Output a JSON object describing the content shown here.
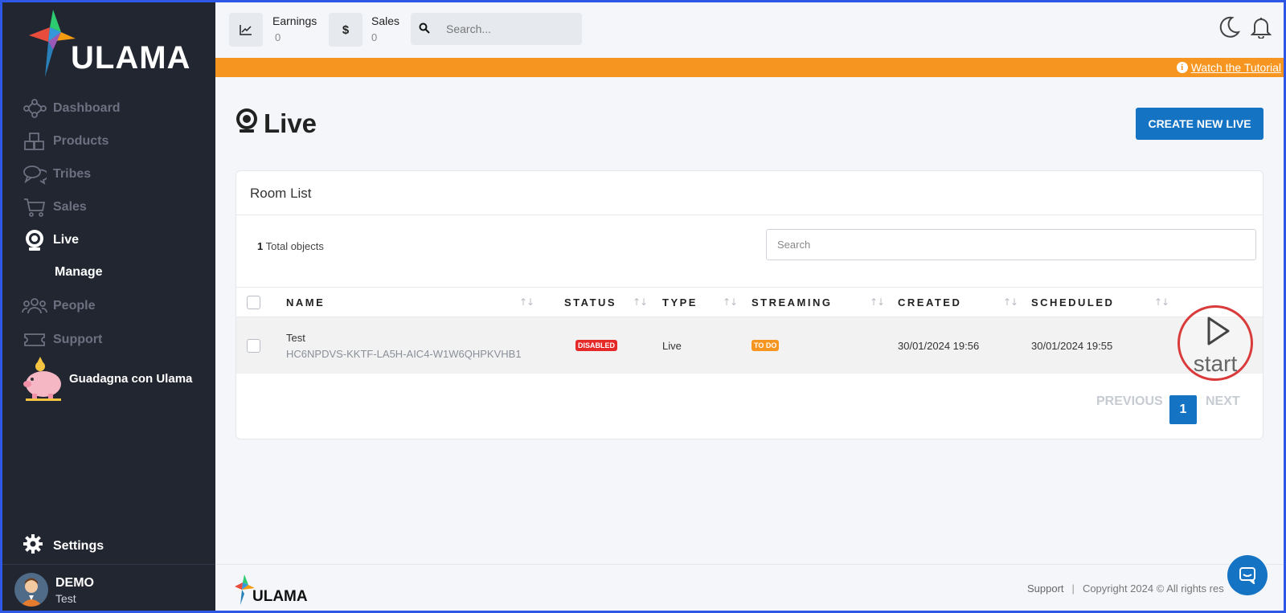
{
  "brand": {
    "logo_text": "ULAMA"
  },
  "sidebar": {
    "items": [
      {
        "label": "Dashboard",
        "icon": "network-icon",
        "active": false
      },
      {
        "label": "Products",
        "icon": "boxes-icon",
        "active": false
      },
      {
        "label": "Tribes",
        "icon": "chat-bubbles-icon",
        "active": false
      },
      {
        "label": "Sales",
        "icon": "cart-icon",
        "active": false
      },
      {
        "label": "Live",
        "icon": "webcam-icon",
        "active": true
      },
      {
        "label": "People",
        "icon": "people-icon",
        "active": false
      },
      {
        "label": "Support",
        "icon": "ticket-icon",
        "active": false
      }
    ],
    "sub_item": "Manage",
    "promo": "Guadagna con Ulama",
    "settings": "Settings",
    "user": {
      "name": "DEMO",
      "sub": "Test"
    }
  },
  "topbar": {
    "earnings": {
      "label": "Earnings",
      "value": "0"
    },
    "sales": {
      "label": "Sales",
      "value": "0"
    },
    "search_placeholder": "Search..."
  },
  "banner": {
    "link": "Watch the Tutorial",
    "color": "#f6951f"
  },
  "page": {
    "title": "Live",
    "create_button": "CREATE NEW LIVE"
  },
  "room_list": {
    "title": "Room List",
    "total_count": "1",
    "total_label": "Total objects",
    "search_placeholder": "Search",
    "columns": [
      "NAME",
      "STATUS",
      "TYPE",
      "STREAMING",
      "CREATED",
      "SCHEDULED"
    ],
    "rows": [
      {
        "name": "Test",
        "id": "HC6NPDVS-KKTF-LA5H-AIC4-W1W6QHPKVHB1",
        "status": "DISABLED",
        "type": "Live",
        "streaming": "TO DO",
        "created": "30/01/2024 19:56",
        "scheduled": "30/01/2024 19:55"
      }
    ],
    "pagination": {
      "previous": "PREVIOUS",
      "current": "1",
      "next": "NEXT"
    }
  },
  "start_overlay": {
    "label": "start"
  },
  "footer": {
    "support": "Support",
    "separator": "|",
    "copyright": "Copyright 2024 © All rights res"
  },
  "colors": {
    "primary": "#1573c4",
    "sidebar": "#222631",
    "danger": "#e52828",
    "warning": "#f6951f"
  }
}
